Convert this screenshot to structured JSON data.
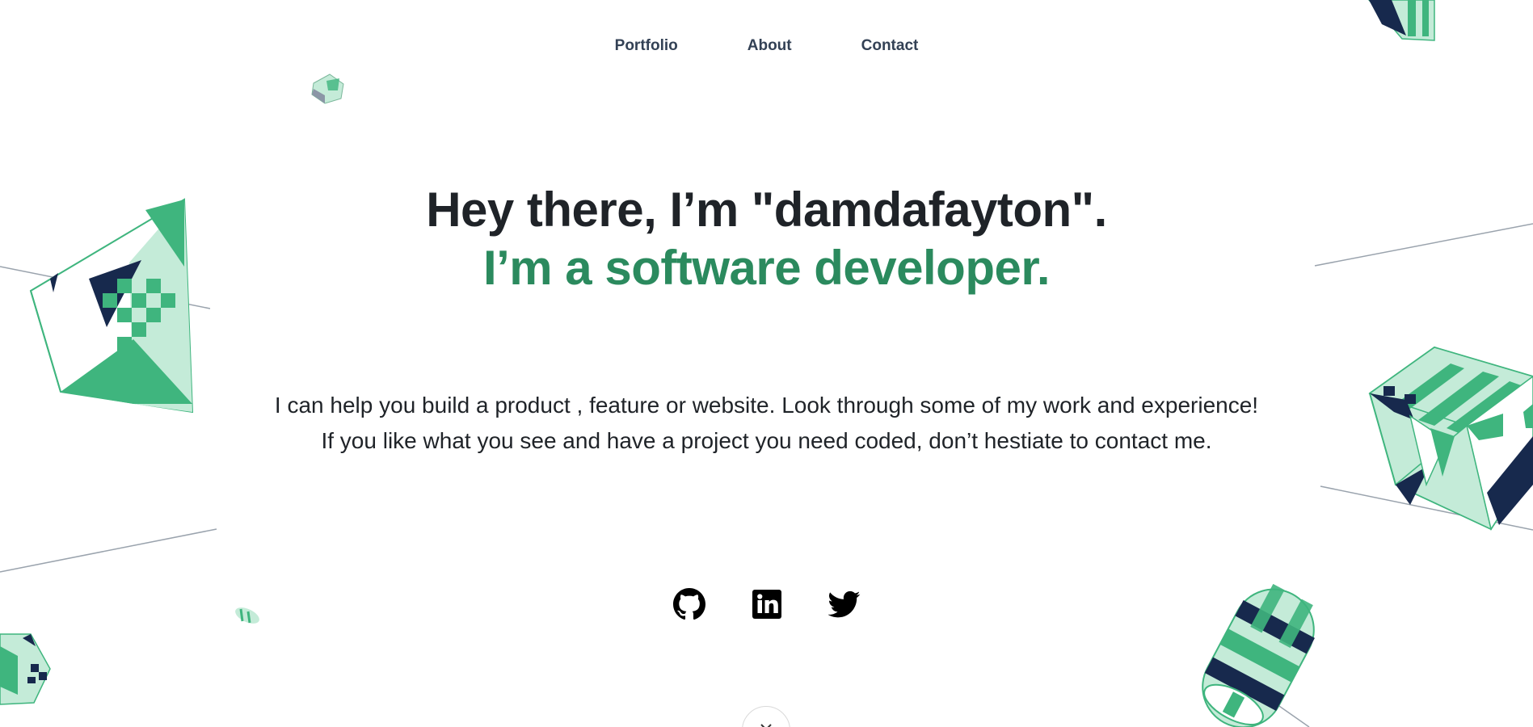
{
  "nav": {
    "items": [
      {
        "label": "Portfolio"
      },
      {
        "label": "About"
      },
      {
        "label": "Contact"
      }
    ]
  },
  "hero": {
    "greeting": "Hey there, I’m \"damdafayton\".",
    "role": "I’m a software developer."
  },
  "intro": {
    "text": "I can help you build a product , feature or website. Look through some of my work and experience! If you like what you see and have a project you need coded, don’t hestiate to contact me."
  },
  "socials": [
    {
      "icon": "github-icon"
    },
    {
      "icon": "linkedin-icon"
    },
    {
      "icon": "twitter-icon"
    }
  ],
  "colors": {
    "accent": "#2b8a5e",
    "shape_green": "#3fb57e",
    "shape_light": "#c4ebd8",
    "shape_navy": "#17294d",
    "text": "#1f2328"
  }
}
